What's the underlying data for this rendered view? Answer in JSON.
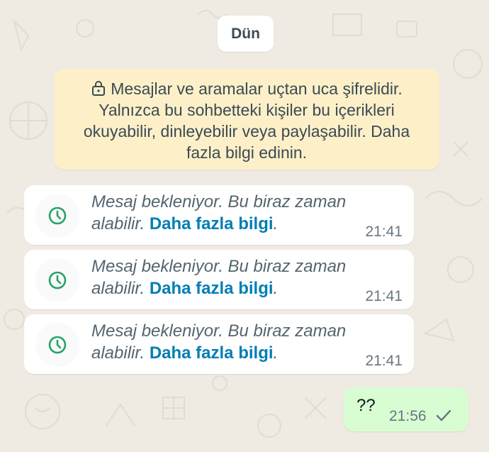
{
  "date_chip": {
    "label": "Dün"
  },
  "encryption_notice": {
    "icon": "lock-icon",
    "text": "Mesajlar ve aramalar uçtan uca şifrelidir. Yalnızca bu sohbetteki kişiler bu içerikleri okuyabilir, dinleyebilir veya paylaşabilir. Daha fazla bilgi edinin."
  },
  "waiting_messages": [
    {
      "icon": "clock-icon",
      "text": "Mesaj bekleniyor. Bu biraz zaman alabilir.",
      "link": "Daha fazla bilgi",
      "suffix": ".",
      "time": "21:41"
    },
    {
      "icon": "clock-icon",
      "text": "Mesaj bekleniyor. Bu biraz zaman alabilir.",
      "link": "Daha fazla bilgi",
      "suffix": ".",
      "time": "21:41"
    },
    {
      "icon": "clock-icon",
      "text": "Mesaj bekleniyor. Bu biraz zaman alabilir.",
      "link": "Daha fazla bilgi",
      "suffix": ".",
      "time": "21:41"
    }
  ],
  "outgoing_message": {
    "text": "??",
    "time": "21:56",
    "status_icon": "single-check-icon"
  },
  "colors": {
    "chat_background": "#efeae2",
    "notice_background": "#fdf0c8",
    "incoming_bubble": "#ffffff",
    "outgoing_bubble": "#d9fdd3",
    "link": "#027eb5",
    "clock_accent": "#25a366"
  }
}
